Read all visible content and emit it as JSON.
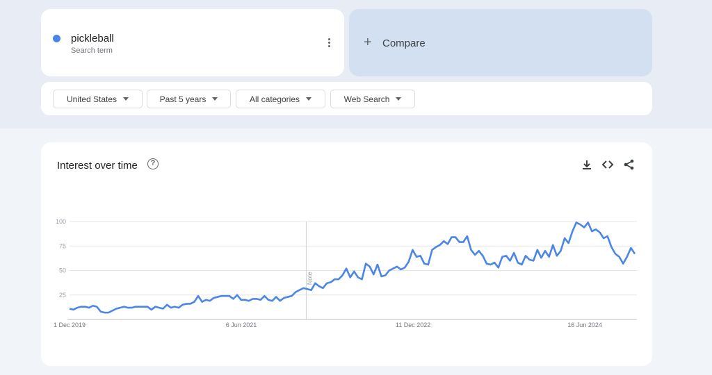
{
  "search_term": {
    "name": "pickleball",
    "subtitle": "Search term",
    "color": "#4a86e8",
    "menu_icon": "more-vert-icon"
  },
  "compare": {
    "label": "Compare",
    "icon": "plus-icon"
  },
  "filters": [
    {
      "label": "United States"
    },
    {
      "label": "Past 5 years"
    },
    {
      "label": "All categories"
    },
    {
      "label": "Web Search"
    }
  ],
  "chart_card": {
    "title": "Interest over time",
    "help_icon": "?",
    "tools": [
      "download-icon",
      "embed-code-icon",
      "share-icon"
    ]
  },
  "chart_data": {
    "type": "line",
    "title": "",
    "xlabel": "",
    "ylabel": "",
    "x_range": [
      "2019-12-01",
      "2024-11-24"
    ],
    "x_tick_labels": [
      "1 Dec 2019",
      "6 Jun 2021",
      "11 Dec 2022",
      "16 Jun 2024"
    ],
    "y_ticks": [
      25,
      50,
      75,
      100
    ],
    "ylim": [
      0,
      100
    ],
    "grid": true,
    "annotation": {
      "label": "Note",
      "date": "2022-01-01"
    },
    "series_color": "#4a86e8",
    "values": [
      11,
      10,
      12,
      13,
      13,
      12,
      14,
      13,
      8,
      7,
      7,
      9,
      11,
      12,
      13,
      12,
      12,
      13,
      13,
      13,
      13,
      10,
      13,
      12,
      11,
      15,
      12,
      13,
      12,
      15,
      16,
      16,
      18,
      24,
      18,
      20,
      19,
      22,
      23,
      24,
      24,
      24,
      21,
      25,
      20,
      20,
      19,
      21,
      21,
      20,
      24,
      20,
      19,
      23,
      19,
      22,
      23,
      24,
      28,
      30,
      32,
      31,
      30,
      37,
      34,
      32,
      37,
      38,
      41,
      41,
      45,
      52,
      43,
      49,
      43,
      41,
      57,
      54,
      46,
      56,
      44,
      45,
      50,
      52,
      54,
      51,
      53,
      59,
      71,
      64,
      65,
      57,
      56,
      71,
      74,
      76,
      80,
      77,
      84,
      84,
      79,
      79,
      85,
      71,
      66,
      70,
      65,
      57,
      56,
      58,
      53,
      64,
      65,
      60,
      68,
      58,
      56,
      65,
      61,
      60,
      71,
      63,
      70,
      64,
      76,
      65,
      70,
      83,
      78,
      90,
      99,
      97,
      94,
      99,
      90,
      92,
      89,
      83,
      85,
      74,
      67,
      64,
      57,
      64,
      73,
      67
    ]
  }
}
